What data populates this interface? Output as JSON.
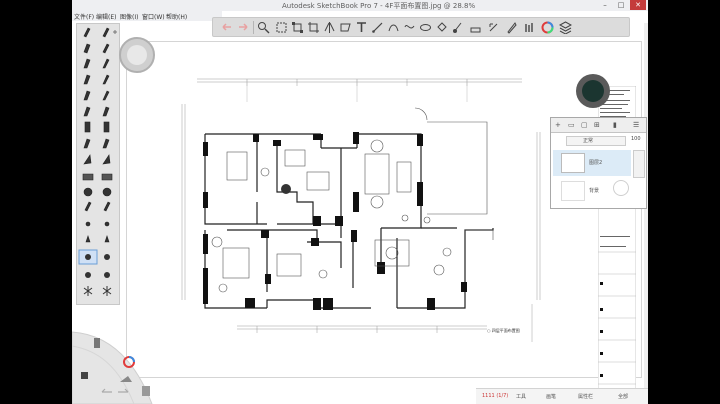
{
  "window": {
    "title": "Autodesk SketchBook Pro 7 - 4F平面布置图.jpg @ 28.8%"
  },
  "window_controls": [
    "–",
    "□",
    "✕"
  ],
  "menu": {
    "items": [
      "文件(F)",
      "编辑(E)",
      "图像(I)",
      "窗口(W)",
      "帮助(H)"
    ]
  },
  "toolbar": {
    "tools": [
      "undo-icon",
      "redo-icon",
      "zoom-icon",
      "select-icon",
      "transform-icon",
      "crop-icon",
      "symmetry-icon",
      "ruler-icon",
      "ellipse-icon",
      "french-curve-icon",
      "text-icon",
      "line-icon",
      "shape-icon",
      "fill-icon",
      "fill-gradient-icon",
      "copic-icon",
      "brush-library-icon",
      "color-editor-icon",
      "layer-editor-icon"
    ]
  },
  "layers": {
    "blend_mode": "正常",
    "opacity": "100",
    "items": [
      {
        "name": "图层2"
      },
      {
        "name": "背景"
      }
    ]
  },
  "status": {
    "left": "1111 (1/7)",
    "mid": "工具",
    "right": "画笔",
    "far": "属性栏",
    "extra": "全部"
  },
  "colors": {
    "active_color": "#1b3530",
    "ui_grey": "#dcdcdc",
    "accent": "#e03b3b"
  }
}
